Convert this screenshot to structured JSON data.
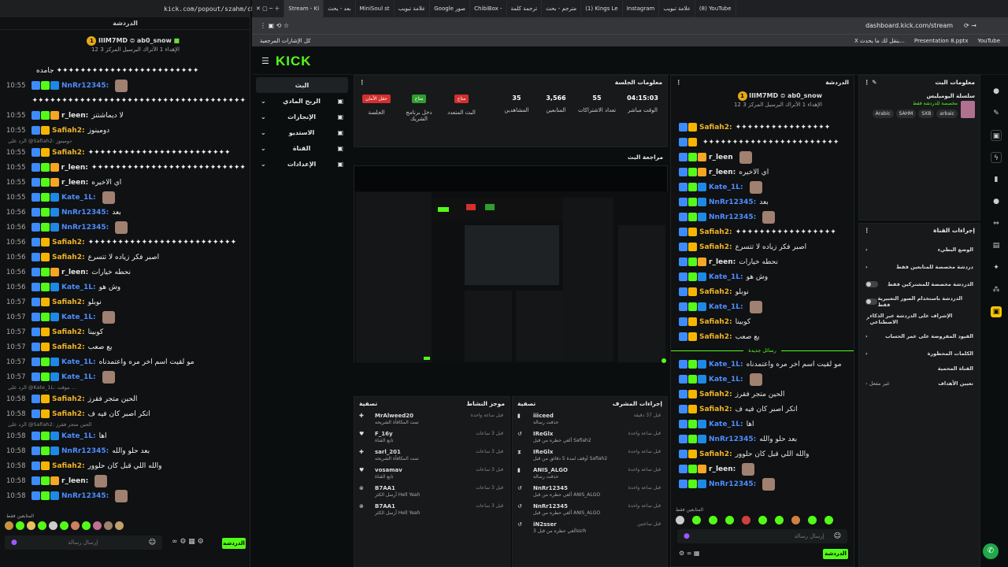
{
  "left_popout": {
    "url": "kick.com/popout/szahm/chat",
    "header": "الدردشة",
    "pinned": {
      "user": "IIIM7MD",
      "mod": "ab0_snow",
      "sub": "12",
      "info": "الإهداء 1 الأتراك البرسيل المركز 3"
    },
    "messages": [
      {
        "t": "",
        "u": "",
        "m": "جامده ✦✦✦✦✦✦✦✦✦✦✦✦✦✦✦✦✦✦✦✦✦✦✦✦",
        "c": "gold",
        "reply": ""
      },
      {
        "t": "10:55",
        "u": "NnRr12345:",
        "m": "",
        "c": "blue",
        "reply": ""
      },
      {
        "t": "",
        "u": "",
        "m": "✦✦✦✦✦✦✦✦✦✦✦✦✦✦✦✦✦✦✦✦✦✦✦✦✦✦✦✦✦✦✦✦✦✦✦✦",
        "c": "gold",
        "reply": ""
      },
      {
        "t": "10:55",
        "u": "r_leen:",
        "m": "لا ديماشتنز",
        "c": "",
        "reply": ""
      },
      {
        "t": "10:55",
        "u": "Safiah2:",
        "m": "دومينوز",
        "c": "gold",
        "reply": ""
      },
      {
        "t": "10:55",
        "u": "Safiah2:",
        "m": "✦✦✦✦✦✦✦✦✦✦✦✦✦✦✦✦✦✦✦✦✦✦✦✦",
        "c": "gold",
        "reply": "الرد على @Safiah2: دومينوز"
      },
      {
        "t": "10:55",
        "u": "r_leen:",
        "m": "✦✦✦✦✦✦✦✦✦✦✦✦✦✦✦✦✦✦✦✦✦✦✦✦✦✦",
        "c": "",
        "reply": ""
      },
      {
        "t": "10:55",
        "u": "r_leen:",
        "m": "اي الاخيره",
        "c": "",
        "reply": ""
      },
      {
        "t": "10:55",
        "u": "Kate_1L:",
        "m": "",
        "c": "blue",
        "reply": ""
      },
      {
        "t": "10:56",
        "u": "NnRr12345:",
        "m": "بعد",
        "c": "blue",
        "reply": ""
      },
      {
        "t": "10:56",
        "u": "NnRr12345:",
        "m": "",
        "c": "blue",
        "reply": ""
      },
      {
        "t": "10:56",
        "u": "Safiah2:",
        "m": "✦✦✦✦✦✦✦✦✦✦✦✦✦✦✦✦✦✦✦✦✦✦✦✦✦",
        "c": "gold",
        "reply": ""
      },
      {
        "t": "10:56",
        "u": "Safiah2:",
        "m": "اصبر فكر زياده لا تتسرع",
        "c": "gold",
        "reply": ""
      },
      {
        "t": "10:56",
        "u": "r_leen:",
        "m": "نحطه خيارات",
        "c": "",
        "reply": ""
      },
      {
        "t": "10:56",
        "u": "Kate_1L:",
        "m": "وش هو",
        "c": "blue",
        "reply": ""
      },
      {
        "t": "10:57",
        "u": "Safiah2:",
        "m": "نوبلو",
        "c": "gold",
        "reply": ""
      },
      {
        "t": "10:57",
        "u": "Kate_1L:",
        "m": "",
        "c": "blue",
        "reply": ""
      },
      {
        "t": "10:57",
        "u": "Safiah2:",
        "m": "كوبينا",
        "c": "gold",
        "reply": ""
      },
      {
        "t": "10:57",
        "u": "Safiah2:",
        "m": "يع صعب",
        "c": "gold",
        "reply": ""
      },
      {
        "t": "10:57",
        "u": "Kate_1L:",
        "m": "مو لقيت اسم اخر مره واعتمدناه",
        "c": "blue",
        "reply": ""
      },
      {
        "t": "10:57",
        "u": "Kate_1L:",
        "m": "",
        "c": "blue",
        "reply": ""
      },
      {
        "t": "10:58",
        "u": "Safiah2:",
        "m": "الحين متجر فقرز",
        "c": "gold",
        "reply": "الرد على @Kate_1L: موقت ..."
      },
      {
        "t": "10:58",
        "u": "Safiah2:",
        "m": "اتكر اصبر كان فيه ف",
        "c": "gold",
        "reply": ""
      },
      {
        "t": "10:58",
        "u": "Kate_1L:",
        "m": "اها",
        "c": "blue",
        "reply": "الرد على @Safiah2: الحين متجر فقرز"
      },
      {
        "t": "10:58",
        "u": "NnRr12345:",
        "m": "بعد حلو والله",
        "c": "blue",
        "reply": ""
      },
      {
        "t": "10:58",
        "u": "Safiah2:",
        "m": "والله اللي قبل كان حلوور",
        "c": "gold",
        "reply": ""
      },
      {
        "t": "10:58",
        "u": "r_leen:",
        "m": "",
        "c": "",
        "reply": ""
      },
      {
        "t": "10:58",
        "u": "NnRr12345:",
        "m": "",
        "c": "blue",
        "reply": ""
      }
    ],
    "followers_only": "المتابعين فقط",
    "input_placeholder": "إرسال رسالة",
    "send_label": "الدردشة"
  },
  "browser": {
    "tabs": [
      "Stream - Ki",
      "بعد - يحث",
      "MiniSoul st",
      "علامة تبويب",
      "Google صور",
      "ChibiBox -",
      "ترجمة كلمة",
      "مترجم - بحث",
      "(1) Kings Le",
      "Instagram",
      "علامة تبويب",
      "(8) YouTube"
    ],
    "url": "dashboard.kick.com/stream",
    "bookmarks_left": "كل الإشارات المرجعية",
    "bookmarks_right": [
      "X ينقل لك ما يحدث...",
      "Presentation 8.pptx",
      "YouTube"
    ]
  },
  "nav": {
    "logo": "KICK",
    "items": [
      "البث",
      "الربح المادي",
      "الإنجازات",
      "الاستديو",
      "القناة",
      "الإعدادات"
    ]
  },
  "session": {
    "title": "معلومات الجلسة",
    "stats": [
      {
        "label": "الوقت مباشر",
        "value": "04:15:03"
      },
      {
        "label": "تعداد الاشتراكات",
        "value": "55"
      },
      {
        "label": "المتابعين",
        "value": "3,566"
      },
      {
        "label": "المشاهدين",
        "value": "35"
      }
    ],
    "pills": [
      {
        "label": "البث المتعدد",
        "text": "متاح",
        "color": "#d32f2f"
      },
      {
        "label": "دخل برنامج الشريك",
        "text": "متاح",
        "color": "#2e9d2e"
      },
      {
        "label": "الجلسة",
        "text": "حقل الأمان",
        "color": "#d32f2f"
      }
    ]
  },
  "preview": {
    "title": "مراجعة البث"
  },
  "activity": {
    "title": "موجز النشاط",
    "filter": "تصفية",
    "rows": [
      {
        "name": "MrAlweed20",
        "sub": "تمت المكافأة الشريحه",
        "time": "قبل ساعة واحدة"
      },
      {
        "name": "F_16y",
        "sub": "تابع القناة",
        "time": "قبل 3 ساعات"
      },
      {
        "name": "sarl_201",
        "sub": "تمت المكافأة الشريحه",
        "time": "قبل 3 ساعات"
      },
      {
        "name": "vosamav",
        "sub": "تابع القناة",
        "time": "قبل 3 ساعات"
      },
      {
        "name": "B7AA1",
        "sub": "أرسل الكثر Hell Yeah",
        "time": "قبل 3 ساعات"
      },
      {
        "name": "B7AA1",
        "sub": "أرسل الكثر Hell Yeah",
        "time": "قبل 3 ساعات"
      }
    ]
  },
  "modactions": {
    "title": "إجراءات المشرف",
    "filter": "تصفية",
    "rows": [
      {
        "name": "iiiceed",
        "sub": "حذفت رسالة",
        "time": "قبل 37 دقيقة"
      },
      {
        "name": "IReGlx",
        "sub": "ألغي حظره من قبل Safiah2",
        "time": "قبل ساعة واحدة"
      },
      {
        "name": "IReGlx",
        "sub": "أوقف لمدة 5 دقائق من قبل Safiah2",
        "time": "قبل ساعة واحدة"
      },
      {
        "name": "ANIS_ALGO",
        "sub": "حذفت رسالة",
        "time": "قبل ساعة واحدة"
      },
      {
        "name": "NnRr12345",
        "sub": "ألغي حظره من قبل ANIS_ALGO",
        "time": "قبل ساعة واحدة"
      },
      {
        "name": "NnRr12345",
        "sub": "ألغي حظره من قبل ANIS_ALGO",
        "time": "قبل ساعة واحدة"
      },
      {
        "name": "iN2sser",
        "sub": "ألغي حظره من قبل 3ssrh",
        "time": "قبل ساعتين"
      }
    ]
  },
  "chat": {
    "title": "الدردشة",
    "pinned": {
      "user": "IIIM7MD",
      "mod": "ab0_snow",
      "sub": "12",
      "info": "الإهداء 1 الأتراك البرسيل المركز 3"
    },
    "new_messages": "رسائل جديدة",
    "messages": [
      {
        "u": "Safiah2:",
        "m": "✦✦✦✦✦✦✦✦✦✦✦✦✦✦✦✦",
        "c": "gold"
      },
      {
        "u": "",
        "m": "✦✦✦✦✦✦✦✦✦✦✦✦✦✦✦✦✦✦✦✦✦✦✦",
        "c": "gold"
      },
      {
        "u": "r_leen",
        "m": "",
        "c": ""
      },
      {
        "u": "r_leen:",
        "m": "اي الاخيره",
        "c": ""
      },
      {
        "u": "Kate_1L:",
        "m": "",
        "c": "blue"
      },
      {
        "u": "NnRr12345:",
        "m": "بعد",
        "c": "blue"
      },
      {
        "u": "NnRr12345:",
        "m": "",
        "c": "blue"
      },
      {
        "u": "Safiah2:",
        "m": "✦✦✦✦✦✦✦✦✦✦✦✦✦✦✦✦✦",
        "c": "gold"
      },
      {
        "u": "Safiah2:",
        "m": "اصبر فكر زياده لا تتسرع",
        "c": "gold"
      },
      {
        "u": "r_leen:",
        "m": "نحطه خيارات",
        "c": ""
      },
      {
        "u": "Kate_1L:",
        "m": "وش هو",
        "c": "blue"
      },
      {
        "u": "Safiah2:",
        "m": "نوبلو",
        "c": "gold"
      },
      {
        "u": "Kate_1L:",
        "m": "",
        "c": "blue"
      },
      {
        "u": "Safiah2:",
        "m": "كوبينا",
        "c": "gold"
      },
      {
        "u": "Safiah2:",
        "m": "يع صعب",
        "c": "gold"
      }
    ],
    "messages2": [
      {
        "u": "Kate_1L:",
        "m": "مو لقيت اسم اخر مره واعتمدناه",
        "c": "blue"
      },
      {
        "u": "Kate_1L:",
        "m": "",
        "c": "blue"
      },
      {
        "u": "Safiah2:",
        "m": "الحين متجر فقرز",
        "c": "gold"
      },
      {
        "u": "Safiah2:",
        "m": "اتكر اصبر كان فيه ف",
        "c": "gold"
      },
      {
        "u": "Kate_1L:",
        "m": "اها",
        "c": "blue"
      },
      {
        "u": "NnRr12345:",
        "m": "بعد حلو والله",
        "c": "blue"
      },
      {
        "u": "Safiah2:",
        "m": "والله اللي قبل كان حلوور",
        "c": "gold"
      },
      {
        "u": "r_leen:",
        "m": "",
        "c": ""
      },
      {
        "u": "NnRr12345:",
        "m": "",
        "c": "blue"
      }
    ],
    "followers_only": "المتابعين فقط",
    "input_placeholder": "إرسال رسالة",
    "send_label": "الدردشة"
  },
  "stream_info": {
    "title": "معلومات البث",
    "stream_title": "سلسلة اليوميليس",
    "category": "مخصصة للدردشة فقط",
    "tags": [
      "Arabic",
      "SAHM",
      "SXB",
      "arbaic"
    ]
  },
  "channel_actions": {
    "title": "إجراءات القناة",
    "rows": [
      "الوضع البطيء",
      "دردشة مخصصة للمتابعين فقط",
      "الدردشة مخصصة للمشتركين فقط",
      "الدردشة باستخدام الصور التعبيرية فقط",
      "الإشراف على الدردشة عبر الذكاء الاصطناعي",
      "القيود المفروضة على عمر الحساب",
      "الكلمات المحظورة"
    ],
    "blocked_channel": "القناة المحمية",
    "goals": "تعيين الأهداف",
    "goals_state": "غير مفعل"
  },
  "colors": {
    "brand": "#53fc18",
    "username_blue": "#4f8cff",
    "username_gold": "#f0b429"
  }
}
